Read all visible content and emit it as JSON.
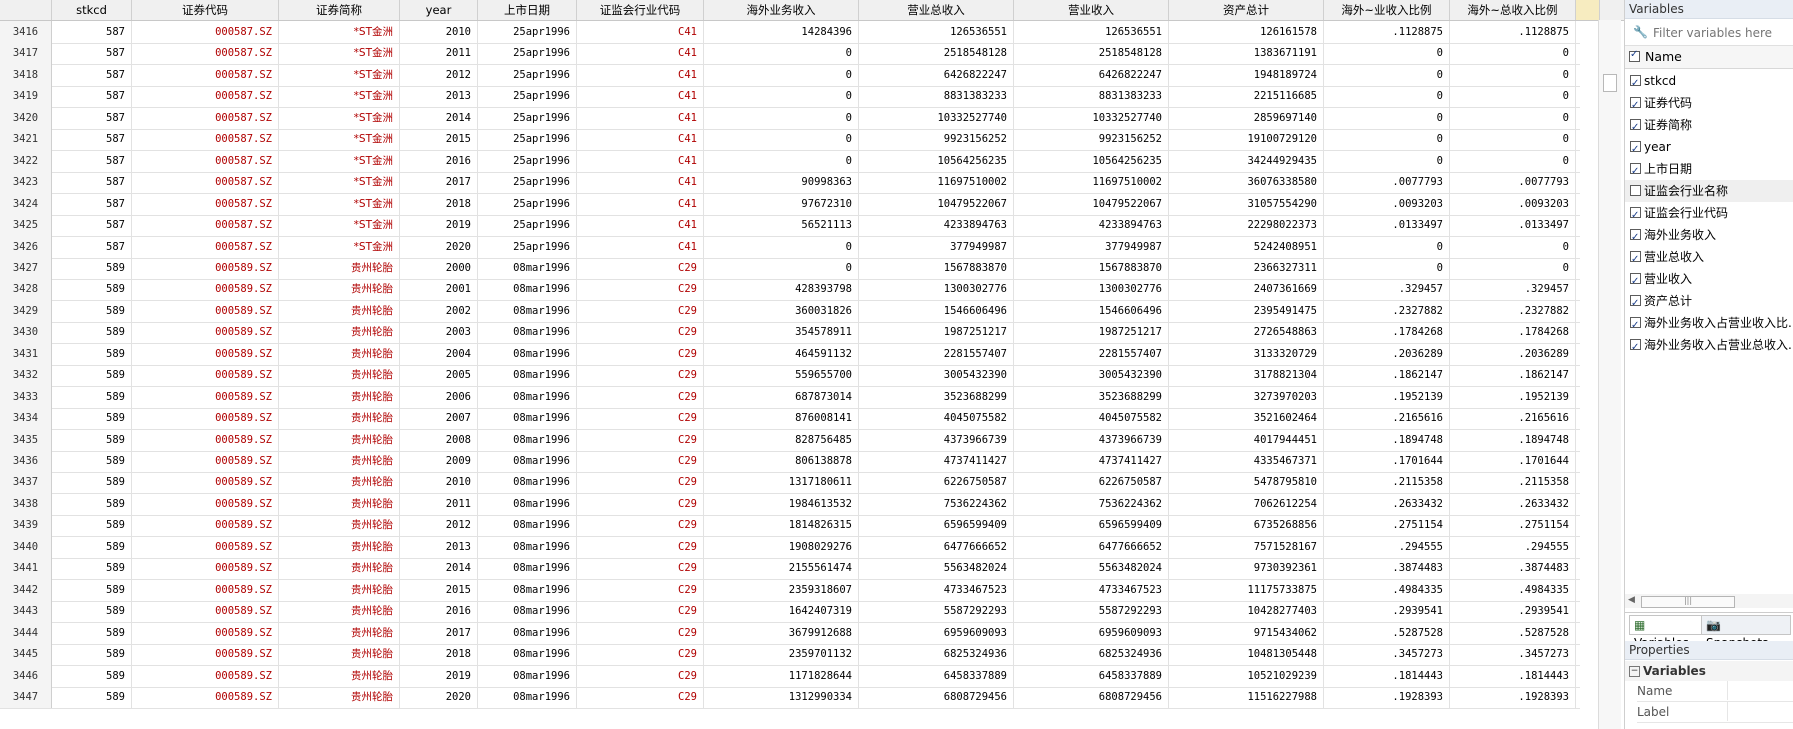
{
  "columns": [
    {
      "key": "idx",
      "label": "",
      "w": 52
    },
    {
      "key": "stkcd",
      "label": "stkcd",
      "w": 80
    },
    {
      "key": "code",
      "label": "证券代码",
      "w": 147
    },
    {
      "key": "abbr",
      "label": "证券简称",
      "w": 121
    },
    {
      "key": "year",
      "label": "year",
      "w": 78
    },
    {
      "key": "list",
      "label": "上市日期",
      "w": 99
    },
    {
      "key": "ind",
      "label": "证监会行业代码",
      "w": 127
    },
    {
      "key": "overseas",
      "label": "海外业务收入",
      "w": 155
    },
    {
      "key": "total",
      "label": "营业总收入",
      "w": 155
    },
    {
      "key": "rev",
      "label": "营业收入",
      "w": 155
    },
    {
      "key": "assets",
      "label": "资产总计",
      "w": 155
    },
    {
      "key": "r1",
      "label": "海外~业收入比例",
      "w": 126
    },
    {
      "key": "r2",
      "label": "海外~总收入比例",
      "w": 126
    },
    {
      "key": "extra",
      "label": "",
      "w": 24
    }
  ],
  "rows": [
    [
      "3416",
      "587",
      "000587.SZ",
      "*ST金洲",
      "2010",
      "25apr1996",
      "C41",
      "14284396",
      "126536551",
      "126536551",
      "126161578",
      ".1128875",
      ".1128875"
    ],
    [
      "3417",
      "587",
      "000587.SZ",
      "*ST金洲",
      "2011",
      "25apr1996",
      "C41",
      "0",
      "2518548128",
      "2518548128",
      "1383671191",
      "0",
      "0"
    ],
    [
      "3418",
      "587",
      "000587.SZ",
      "*ST金洲",
      "2012",
      "25apr1996",
      "C41",
      "0",
      "6426822247",
      "6426822247",
      "1948189724",
      "0",
      "0"
    ],
    [
      "3419",
      "587",
      "000587.SZ",
      "*ST金洲",
      "2013",
      "25apr1996",
      "C41",
      "0",
      "8831383233",
      "8831383233",
      "2215116685",
      "0",
      "0"
    ],
    [
      "3420",
      "587",
      "000587.SZ",
      "*ST金洲",
      "2014",
      "25apr1996",
      "C41",
      "0",
      "10332527740",
      "10332527740",
      "2859697140",
      "0",
      "0"
    ],
    [
      "3421",
      "587",
      "000587.SZ",
      "*ST金洲",
      "2015",
      "25apr1996",
      "C41",
      "0",
      "9923156252",
      "9923156252",
      "19100729120",
      "0",
      "0"
    ],
    [
      "3422",
      "587",
      "000587.SZ",
      "*ST金洲",
      "2016",
      "25apr1996",
      "C41",
      "0",
      "10564256235",
      "10564256235",
      "34244929435",
      "0",
      "0"
    ],
    [
      "3423",
      "587",
      "000587.SZ",
      "*ST金洲",
      "2017",
      "25apr1996",
      "C41",
      "90998363",
      "11697510002",
      "11697510002",
      "36076338580",
      ".0077793",
      ".0077793"
    ],
    [
      "3424",
      "587",
      "000587.SZ",
      "*ST金洲",
      "2018",
      "25apr1996",
      "C41",
      "97672310",
      "10479522067",
      "10479522067",
      "31057554290",
      ".0093203",
      ".0093203"
    ],
    [
      "3425",
      "587",
      "000587.SZ",
      "*ST金洲",
      "2019",
      "25apr1996",
      "C41",
      "56521113",
      "4233894763",
      "4233894763",
      "22298022373",
      ".0133497",
      ".0133497"
    ],
    [
      "3426",
      "587",
      "000587.SZ",
      "*ST金洲",
      "2020",
      "25apr1996",
      "C41",
      "0",
      "377949987",
      "377949987",
      "5242408951",
      "0",
      "0"
    ],
    [
      "3427",
      "589",
      "000589.SZ",
      "贵州轮胎",
      "2000",
      "08mar1996",
      "C29",
      "0",
      "1567883870",
      "1567883870",
      "2366327311",
      "0",
      "0"
    ],
    [
      "3428",
      "589",
      "000589.SZ",
      "贵州轮胎",
      "2001",
      "08mar1996",
      "C29",
      "428393798",
      "1300302776",
      "1300302776",
      "2407361669",
      ".329457",
      ".329457"
    ],
    [
      "3429",
      "589",
      "000589.SZ",
      "贵州轮胎",
      "2002",
      "08mar1996",
      "C29",
      "360031826",
      "1546606496",
      "1546606496",
      "2395491475",
      ".2327882",
      ".2327882"
    ],
    [
      "3430",
      "589",
      "000589.SZ",
      "贵州轮胎",
      "2003",
      "08mar1996",
      "C29",
      "354578911",
      "1987251217",
      "1987251217",
      "2726548863",
      ".1784268",
      ".1784268"
    ],
    [
      "3431",
      "589",
      "000589.SZ",
      "贵州轮胎",
      "2004",
      "08mar1996",
      "C29",
      "464591132",
      "2281557407",
      "2281557407",
      "3133320729",
      ".2036289",
      ".2036289"
    ],
    [
      "3432",
      "589",
      "000589.SZ",
      "贵州轮胎",
      "2005",
      "08mar1996",
      "C29",
      "559655700",
      "3005432390",
      "3005432390",
      "3178821304",
      ".1862147",
      ".1862147"
    ],
    [
      "3433",
      "589",
      "000589.SZ",
      "贵州轮胎",
      "2006",
      "08mar1996",
      "C29",
      "687873014",
      "3523688299",
      "3523688299",
      "3273970203",
      ".1952139",
      ".1952139"
    ],
    [
      "3434",
      "589",
      "000589.SZ",
      "贵州轮胎",
      "2007",
      "08mar1996",
      "C29",
      "876008141",
      "4045075582",
      "4045075582",
      "3521602464",
      ".2165616",
      ".2165616"
    ],
    [
      "3435",
      "589",
      "000589.SZ",
      "贵州轮胎",
      "2008",
      "08mar1996",
      "C29",
      "828756485",
      "4373966739",
      "4373966739",
      "4017944451",
      ".1894748",
      ".1894748"
    ],
    [
      "3436",
      "589",
      "000589.SZ",
      "贵州轮胎",
      "2009",
      "08mar1996",
      "C29",
      "806138878",
      "4737411427",
      "4737411427",
      "4335467371",
      ".1701644",
      ".1701644"
    ],
    [
      "3437",
      "589",
      "000589.SZ",
      "贵州轮胎",
      "2010",
      "08mar1996",
      "C29",
      "1317180611",
      "6226750587",
      "6226750587",
      "5478795810",
      ".2115358",
      ".2115358"
    ],
    [
      "3438",
      "589",
      "000589.SZ",
      "贵州轮胎",
      "2011",
      "08mar1996",
      "C29",
      "1984613532",
      "7536224362",
      "7536224362",
      "7062612254",
      ".2633432",
      ".2633432"
    ],
    [
      "3439",
      "589",
      "000589.SZ",
      "贵州轮胎",
      "2012",
      "08mar1996",
      "C29",
      "1814826315",
      "6596599409",
      "6596599409",
      "6735268856",
      ".2751154",
      ".2751154"
    ],
    [
      "3440",
      "589",
      "000589.SZ",
      "贵州轮胎",
      "2013",
      "08mar1996",
      "C29",
      "1908029276",
      "6477666652",
      "6477666652",
      "7571528167",
      ".294555",
      ".294555"
    ],
    [
      "3441",
      "589",
      "000589.SZ",
      "贵州轮胎",
      "2014",
      "08mar1996",
      "C29",
      "2155561474",
      "5563482024",
      "5563482024",
      "9730392361",
      ".3874483",
      ".3874483"
    ],
    [
      "3442",
      "589",
      "000589.SZ",
      "贵州轮胎",
      "2015",
      "08mar1996",
      "C29",
      "2359318607",
      "4733467523",
      "4733467523",
      "11175733875",
      ".4984335",
      ".4984335"
    ],
    [
      "3443",
      "589",
      "000589.SZ",
      "贵州轮胎",
      "2016",
      "08mar1996",
      "C29",
      "1642407319",
      "5587292293",
      "5587292293",
      "10428277403",
      ".2939541",
      ".2939541"
    ],
    [
      "3444",
      "589",
      "000589.SZ",
      "贵州轮胎",
      "2017",
      "08mar1996",
      "C29",
      "3679912688",
      "6959609093",
      "6959609093",
      "9715434062",
      ".5287528",
      ".5287528"
    ],
    [
      "3445",
      "589",
      "000589.SZ",
      "贵州轮胎",
      "2018",
      "08mar1996",
      "C29",
      "2359701132",
      "6825324936",
      "6825324936",
      "10481305448",
      ".3457273",
      ".3457273"
    ],
    [
      "3446",
      "589",
      "000589.SZ",
      "贵州轮胎",
      "2019",
      "08mar1996",
      "C29",
      "1171828644",
      "6458337889",
      "6458337889",
      "10521029239",
      ".1814443",
      ".1814443"
    ],
    [
      "3447",
      "589",
      "000589.SZ",
      "贵州轮胎",
      "2020",
      "08mar1996",
      "C29",
      "1312990334",
      "6808729456",
      "6808729456",
      "11516227988",
      ".1928393",
      ".1928393"
    ]
  ],
  "colors": {
    "string_text": "#b00000",
    "header_bg": "#f0f0f0",
    "selected_header": "#f7ecc0"
  },
  "panel": {
    "variables_title": "Variables",
    "filter_placeholder": "Filter variables here",
    "name_header": "Name",
    "items": [
      {
        "label": "stkcd",
        "checked": true
      },
      {
        "label": "证券代码",
        "checked": true
      },
      {
        "label": "证券简称",
        "checked": true
      },
      {
        "label": "year",
        "checked": true
      },
      {
        "label": "上市日期",
        "checked": true
      },
      {
        "label": "证监会行业名称",
        "checked": false
      },
      {
        "label": "证监会行业代码",
        "checked": true
      },
      {
        "label": "海外业务收入",
        "checked": true
      },
      {
        "label": "营业总收入",
        "checked": true
      },
      {
        "label": "营业收入",
        "checked": true
      },
      {
        "label": "资产总计",
        "checked": true
      },
      {
        "label": "海外业务收入占营业收入比...",
        "checked": true
      },
      {
        "label": "海外业务收入占营业总收入...",
        "checked": true
      }
    ],
    "tab_variables": "Variables",
    "tab_snapshots": "Snapshots",
    "properties_title": "Properties",
    "properties_section": "Variables",
    "prop_rows": [
      "Name",
      "Label"
    ]
  }
}
